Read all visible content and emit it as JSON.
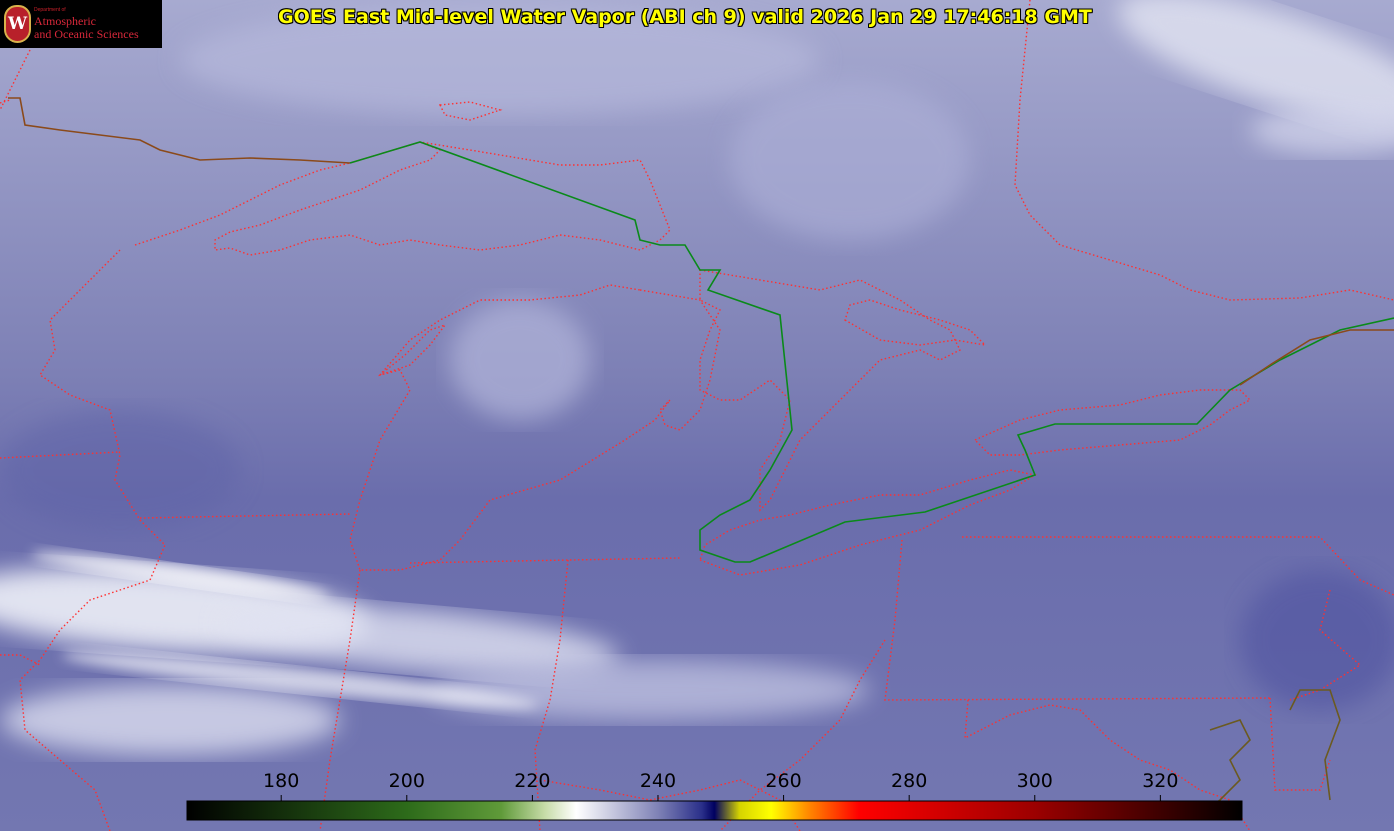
{
  "header": {
    "title": "GOES East Mid-level Water Vapor (ABI ch 9)  valid 2026 Jan 29 17:46:18 GMT"
  },
  "logo": {
    "department": "Department of",
    "line1": "Atmospheric",
    "line2": "and Oceanic Sciences",
    "seal_letter": "W"
  },
  "colorbar": {
    "min": 165,
    "max": 333,
    "tick_labels": [
      "180",
      "200",
      "220",
      "240",
      "260",
      "280",
      "300",
      "320"
    ],
    "stops": [
      {
        "t": 165,
        "c": "#000000"
      },
      {
        "t": 200,
        "c": "#2d6b1a"
      },
      {
        "t": 215,
        "c": "#5f9a39"
      },
      {
        "t": 222,
        "c": "#c7dca8"
      },
      {
        "t": 227,
        "c": "#ffffff"
      },
      {
        "t": 240,
        "c": "#7f82b6"
      },
      {
        "t": 247,
        "c": "#2a2f8a"
      },
      {
        "t": 249,
        "c": "#000060"
      },
      {
        "t": 253,
        "c": "#d6d400"
      },
      {
        "t": 258,
        "c": "#ffff00"
      },
      {
        "t": 264,
        "c": "#ff8800"
      },
      {
        "t": 272,
        "c": "#ff0000"
      },
      {
        "t": 300,
        "c": "#9c0000"
      },
      {
        "t": 333,
        "c": "#000000"
      }
    ]
  },
  "colors": {
    "background": "#7f82b6",
    "boundary": "#ff3030",
    "international_border": "#0a8a1a",
    "title_text": "#ffff00"
  }
}
